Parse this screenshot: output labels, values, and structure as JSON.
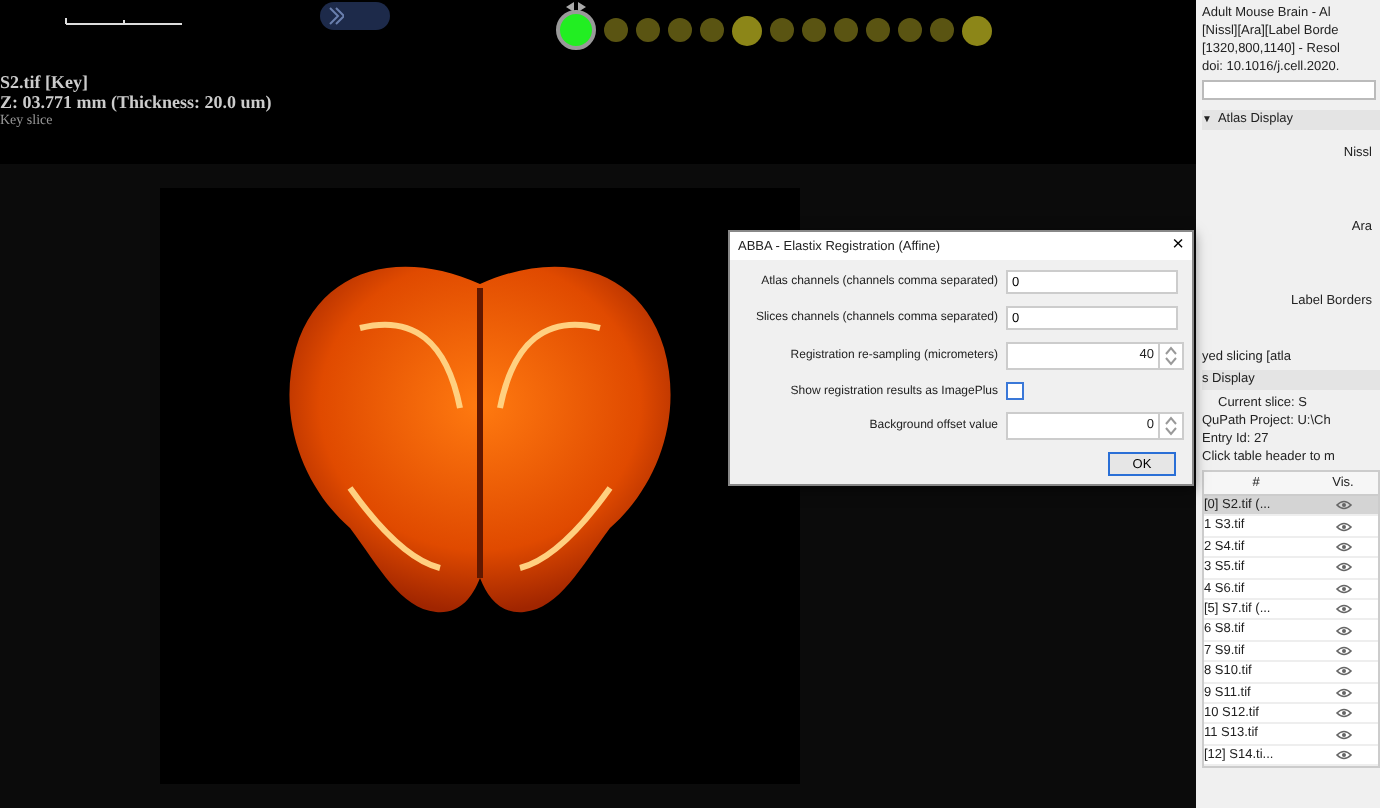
{
  "viewer": {
    "slice_title": "S2.tif [Key]",
    "z_position": "Z: 03.771 mm (Thickness: 20.0 um)",
    "slice_note": "Key slice",
    "slice_dots": [
      {
        "key": true,
        "selected": true
      },
      {
        "key": false,
        "selected": false
      },
      {
        "key": false,
        "selected": false
      },
      {
        "key": false,
        "selected": false
      },
      {
        "key": false,
        "selected": false
      },
      {
        "key": true,
        "selected": false
      },
      {
        "key": false,
        "selected": false
      },
      {
        "key": false,
        "selected": false
      },
      {
        "key": false,
        "selected": false
      },
      {
        "key": false,
        "selected": false
      },
      {
        "key": false,
        "selected": false
      },
      {
        "key": false,
        "selected": false
      },
      {
        "key": true,
        "selected": false
      }
    ]
  },
  "dialog": {
    "title": "ABBA - Elastix Registration (Affine)",
    "close": "×",
    "fields": [
      {
        "kind": "text",
        "label": "Atlas channels (channels comma separated)",
        "value": "0"
      },
      {
        "kind": "text",
        "label": "Slices channels (channels comma separated)",
        "value": "0"
      },
      {
        "kind": "spinner",
        "label": "Registration re-sampling (micrometers)",
        "value": "40"
      },
      {
        "kind": "checkbox",
        "label": "Show registration results as ImagePlus",
        "checked": false
      },
      {
        "kind": "spinner",
        "label": "Background offset value",
        "value": "0"
      }
    ],
    "ok": "OK"
  },
  "side_panel": {
    "info_lines": [
      "Adult Mouse Brain - Al",
      "[Nissl][Ara][Label Borde",
      "[1320,800,1140] - Resol",
      "doi: 10.1016/j.cell.2020."
    ],
    "section_glyph": "▼",
    "section": "Atlas Display",
    "atlas_labels": [
      "Nissl",
      "Ara",
      "Label Borders"
    ],
    "slicing_label": "yed slicing [atla",
    "display_section": "s Display",
    "current_slice": "Current slice: S",
    "project": "QuPath Project: U:\\Ch",
    "entry": "Entry Id: 27",
    "hint": "Click table header to m",
    "columns": [
      "#",
      "Vis."
    ],
    "rows": [
      {
        "label": "[0] S2.tif (...",
        "selected": true
      },
      {
        "label": "1  S3.tif",
        "selected": false
      },
      {
        "label": "2  S4.tif",
        "selected": false
      },
      {
        "label": "3  S5.tif",
        "selected": false
      },
      {
        "label": "4  S6.tif",
        "selected": false
      },
      {
        "label": "[5] S7.tif (...",
        "selected": false
      },
      {
        "label": "6  S8.tif",
        "selected": false
      },
      {
        "label": "7  S9.tif",
        "selected": false
      },
      {
        "label": "8  S10.tif",
        "selected": false
      },
      {
        "label": "9  S11.tif",
        "selected": false
      },
      {
        "label": "10  S12.tif",
        "selected": false
      },
      {
        "label": "11  S13.tif",
        "selected": false
      },
      {
        "label": "[12] S14.ti...",
        "selected": false
      }
    ]
  }
}
